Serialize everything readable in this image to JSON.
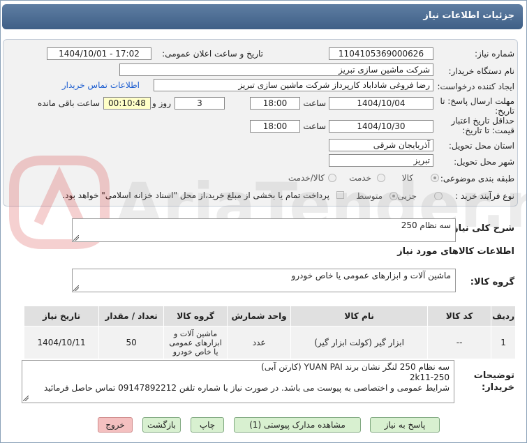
{
  "window": {
    "title": "جزئیات اطلاعات نیاز"
  },
  "form": {
    "need_number_label": "شماره نیاز:",
    "need_number": "1104105369000626",
    "announce_label": "تاریخ و ساعت اعلان عمومی:",
    "announce_value": "1404/10/01 - 17:02",
    "buyer_org_label": "نام دستگاه خریدار:",
    "buyer_org": "شرکت ماشین سازی تبریز",
    "creator_label": "ایجاد کننده درخواست:",
    "creator": "رضا فروغی شاداباد کارپرداز شرکت ماشین سازی تبریز",
    "contact_link": "اطلاعات تماس خریدار",
    "deadline_label": "مهلت ارسال پاسخ: تا تاریخ:",
    "deadline_date": "1404/10/04",
    "time_label": "ساعت",
    "deadline_time": "18:00",
    "days_value": "3",
    "days_label": "روز و",
    "remaining_time": "00:10:48",
    "remaining_label": "ساعت باقی مانده",
    "validity_label": "حداقل تاریخ اعتبار قیمت: تا تاریخ:",
    "validity_date": "1404/10/30",
    "validity_time": "18:00",
    "province_label": "استان محل تحویل:",
    "province": "آذربایجان شرقی",
    "city_label": "شهر محل تحویل:",
    "city": "تبریز",
    "category_label": "طبقه بندی موضوعی:",
    "category_options": [
      "کالا",
      "خدمت",
      "کالا/خدمت"
    ],
    "process_label": "نوع فرآیند خرید :",
    "process_options": [
      "جزیی",
      "متوسط"
    ],
    "payment_note": "پرداخت تمام یا بخشی از مبلغ خرید،از محل \"اسناد خزانه اسلامی\" خواهد بود."
  },
  "need_desc": {
    "label": "شرح کلی نیاز:",
    "value": "سه نظام 250"
  },
  "goods_info_title": "اطلاعات کالاهای مورد نیاز",
  "goods_group": {
    "label": "گروه کالا:",
    "value": "ماشین آلات و ابزارهای عمومی یا خاص خودرو"
  },
  "table": {
    "headers": [
      "ردیف",
      "کد کالا",
      "نام کالا",
      "واحد شمارش",
      "گروه کالا",
      "تعداد / مقدار",
      "تاریخ نیاز"
    ],
    "rows": [
      {
        "row": "1",
        "code": "--",
        "name": "ابزار گیر (کولت ابزار گیر)",
        "unit": "عدد",
        "group": "ماشین آلات و ابزارهای عمومی یا خاص خودرو",
        "qty": "50",
        "date": "1404/10/11"
      }
    ]
  },
  "buyer_notes": {
    "label": "توضیحات خریدار:",
    "lines": [
      "سه نظام 250 لنگر نشان برند YUAN PAI (کارتن آبی)",
      "2k11-250",
      "شرایط عمومی و اختصاصی به پیوست می باشد. در صورت نیاز با شماره تلفن 09147892212 تماس حاصل فرمائید"
    ]
  },
  "buttons": {
    "reply": "پاسخ به نیاز",
    "view_docs": "مشاهده مدارک پیوستی (1)",
    "print": "چاپ",
    "back": "بازگشت",
    "exit": "خروج"
  },
  "watermark": "AriaTender.neT"
}
